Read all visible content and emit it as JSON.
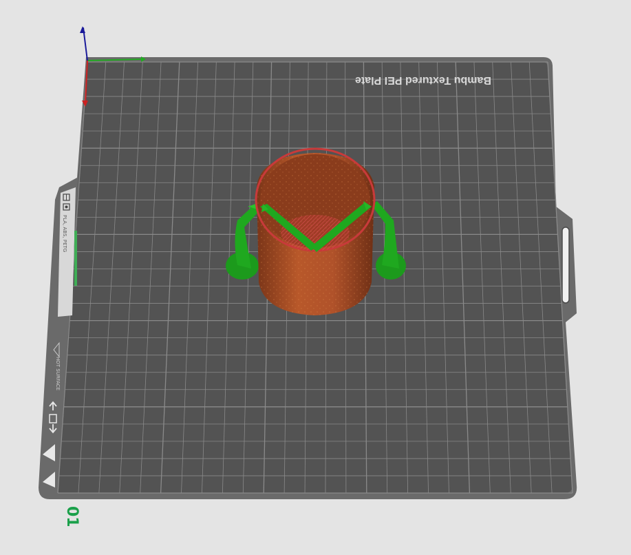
{
  "plate": {
    "title": "Bambu Textured PEI Plate",
    "number": "01",
    "sidebar_filament_text": "PLA, ABS, PETG",
    "sidebar_warning_text": "HOT SURFACE",
    "colors": {
      "plate_surface": "#535353",
      "plate_border": "#6a6a6a",
      "grid_line": "#8a8a8a",
      "background": "#e4e4e4",
      "plate_number": "#1aa04a"
    }
  },
  "axes": {
    "x_color": "#22aa22",
    "y_color": "#cc2222",
    "z_color": "#1a1a9a"
  },
  "model": {
    "object_color": "#b0542a",
    "support_color": "#1fa81f",
    "top_layer_color": "#c83a3a"
  },
  "icons": {
    "sidebar": [
      "layout-icon",
      "filament-icon",
      "warning-icon",
      "arrow-up-icon",
      "screen-icon",
      "arrow-down-icon"
    ]
  }
}
